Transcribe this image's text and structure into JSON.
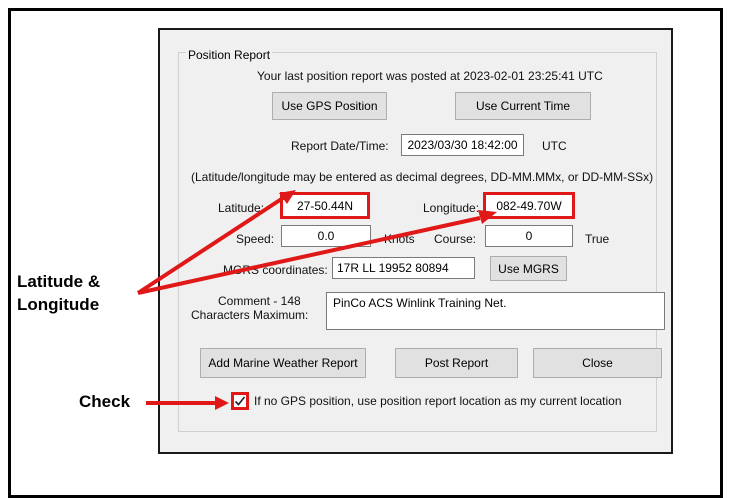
{
  "group": {
    "title": "Position Report"
  },
  "last_report": "Your last position report was posted at 2023-02-01 23:25:41 UTC",
  "buttons": {
    "use_gps": "Use GPS Position",
    "use_time": "Use Current Time",
    "use_mgrs": "Use MGRS",
    "add_weather": "Add Marine Weather Report",
    "post_report": "Post Report",
    "close": "Close"
  },
  "report_datetime": {
    "label": "Report Date/Time:",
    "value": "2023/03/30 18:42:00",
    "unit": "UTC"
  },
  "hint": "(Latitude/longitude may be entered as decimal degrees, DD-MM.MMx, or DD-MM-SSx)",
  "latitude": {
    "label": "Latitude:",
    "value": "27-50.44N"
  },
  "longitude": {
    "label": "Longitude:",
    "value": "082-49.70W"
  },
  "speed": {
    "label": "Speed:",
    "value": "0.0",
    "unit": "Knots"
  },
  "course": {
    "label": "Course:",
    "value": "0",
    "unit": "True"
  },
  "mgrs": {
    "label": "MGRS coordinates:",
    "value": "17R LL 19952 80894"
  },
  "comment": {
    "label_line1": "Comment - 148",
    "label_line2": "Characters Maximum:",
    "value": "PinCo ACS Winlink Training Net."
  },
  "checkbox": {
    "label": "If no GPS position, use position report location as my current location",
    "checked": true
  },
  "annotations": {
    "lat_long_line1": "Latitude &",
    "lat_long_line2": "Longitude",
    "check": "Check"
  },
  "colors": {
    "highlight": "#e01818",
    "dialog_bg": "#f0f0f0",
    "button_bg": "#e1e1e1"
  }
}
